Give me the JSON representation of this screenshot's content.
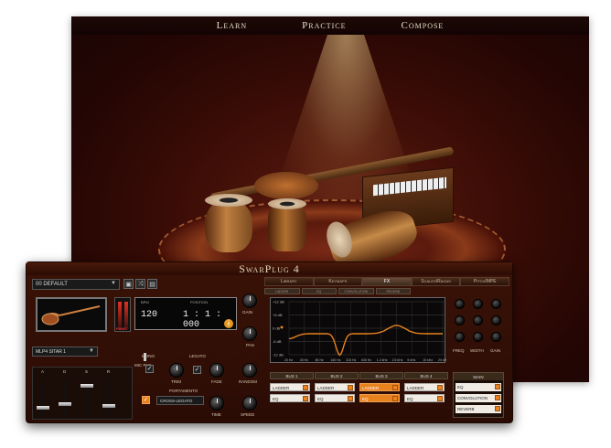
{
  "nav": {
    "items": [
      "Learn",
      "Practice",
      "Compose"
    ]
  },
  "plugin": {
    "title": "SwarPlug 4",
    "preset": "00 DEFAULT",
    "instrument": "MLP4 SITAR 1",
    "transport": {
      "bpm_label": "BPM",
      "bpm": "120",
      "position_label": "POSITION",
      "position": "1 : 1 : 000"
    },
    "panic_label": "PANIC",
    "mono_label": "MONO",
    "mic_pan_label": "MIC PAN",
    "legato_label": "LEGATO",
    "portamento_label": "PORTAMENTO",
    "portamento_mode": "CROSS-LEGATO",
    "knobs": {
      "gain": "GAIN",
      "pan": "PAN",
      "trim": "TRIM",
      "fade": "FADE",
      "random": "RANDOM",
      "time": "TIME",
      "speed": "SPEED"
    },
    "fader_letters": [
      "A",
      "D",
      "S",
      "R"
    ]
  },
  "tabs": [
    "Library",
    "Keymaps",
    "FX",
    "Scales/Ragas",
    "Pitch/MPE"
  ],
  "active_tab": "FX",
  "subtabs": [
    "LADDER",
    "EQ",
    "CONVOLUTION",
    "REVERB"
  ],
  "eq": {
    "y_labels": [
      "+12 dB",
      "+6 dB",
      "0 dB",
      "-6 dB",
      "-12 dB"
    ],
    "x_labels": [
      "20 Hz",
      "40 Hz",
      "80 Hz",
      "160 Hz",
      "315 Hz",
      "630 Hz",
      "1.2 kHz",
      "2.5 kHz",
      "5 kHz",
      "10 kHz",
      "20 kHz"
    ],
    "knob_labels": [
      "FREQ",
      "WIDTH",
      "GAIN"
    ]
  },
  "buses": [
    {
      "name": "BUS 1",
      "slots": [
        {
          "label": "LADDER",
          "active": false
        },
        {
          "label": "EQ",
          "active": false
        }
      ]
    },
    {
      "name": "BUS 2",
      "slots": [
        {
          "label": "LADDER",
          "active": false
        },
        {
          "label": "EQ",
          "active": false
        }
      ]
    },
    {
      "name": "BUS 3",
      "slots": [
        {
          "label": "LADDER",
          "active": true
        },
        {
          "label": "EQ",
          "active": true
        }
      ]
    },
    {
      "name": "BUS 4",
      "slots": [
        {
          "label": "LADDER",
          "active": false
        },
        {
          "label": "EQ",
          "active": false
        }
      ]
    }
  ],
  "main": {
    "title": "MAIN",
    "items": [
      "EQ",
      "CONVOLUTION",
      "REVERB"
    ]
  },
  "colors": {
    "accent": "#e8821e",
    "stage_bg": "#3a0c06",
    "eq_curve": "#e8821e"
  }
}
